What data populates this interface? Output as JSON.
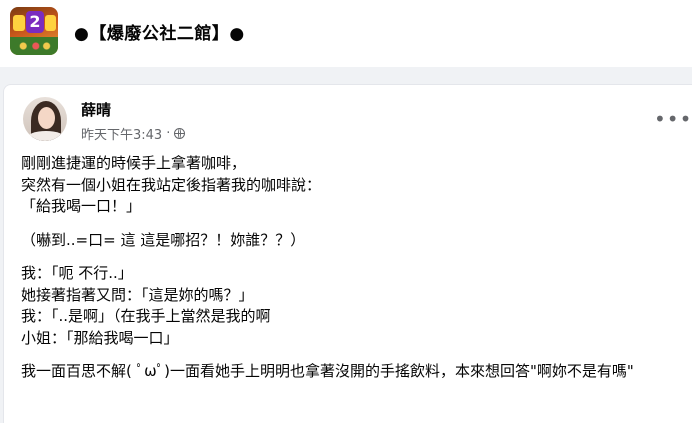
{
  "group": {
    "name": "●【爆廢公社二館】●",
    "icon_number": "2"
  },
  "post": {
    "author": "薛晴",
    "timestamp": "昨天下午3:43",
    "dot": "·",
    "more_label": "•••",
    "paragraphs": [
      [
        "剛剛進捷運的時候手上拿著咖啡，",
        "突然有一個小姐在我站定後指著我的咖啡說：",
        "「給我喝一口！」"
      ],
      [
        "（嚇到..=口= 這 這是哪招？！妳誰？？）"
      ],
      [
        "我：「呃 不行..」",
        "她接著指著又問：「這是妳的嗎？」",
        "我：「..是啊」（在我手上當然是我的啊",
        "小姐：「那給我喝一口」"
      ],
      [
        "我一面百思不解( ﾟωﾟ)一面看她手上明明也拿著沒開的手搖飲料，本來想回答\"啊妳不是有嗎\""
      ]
    ]
  },
  "colors": {
    "background": "#f0f2f5",
    "card": "#ffffff",
    "secondary_text": "#65676b",
    "primary_text": "#050505"
  }
}
